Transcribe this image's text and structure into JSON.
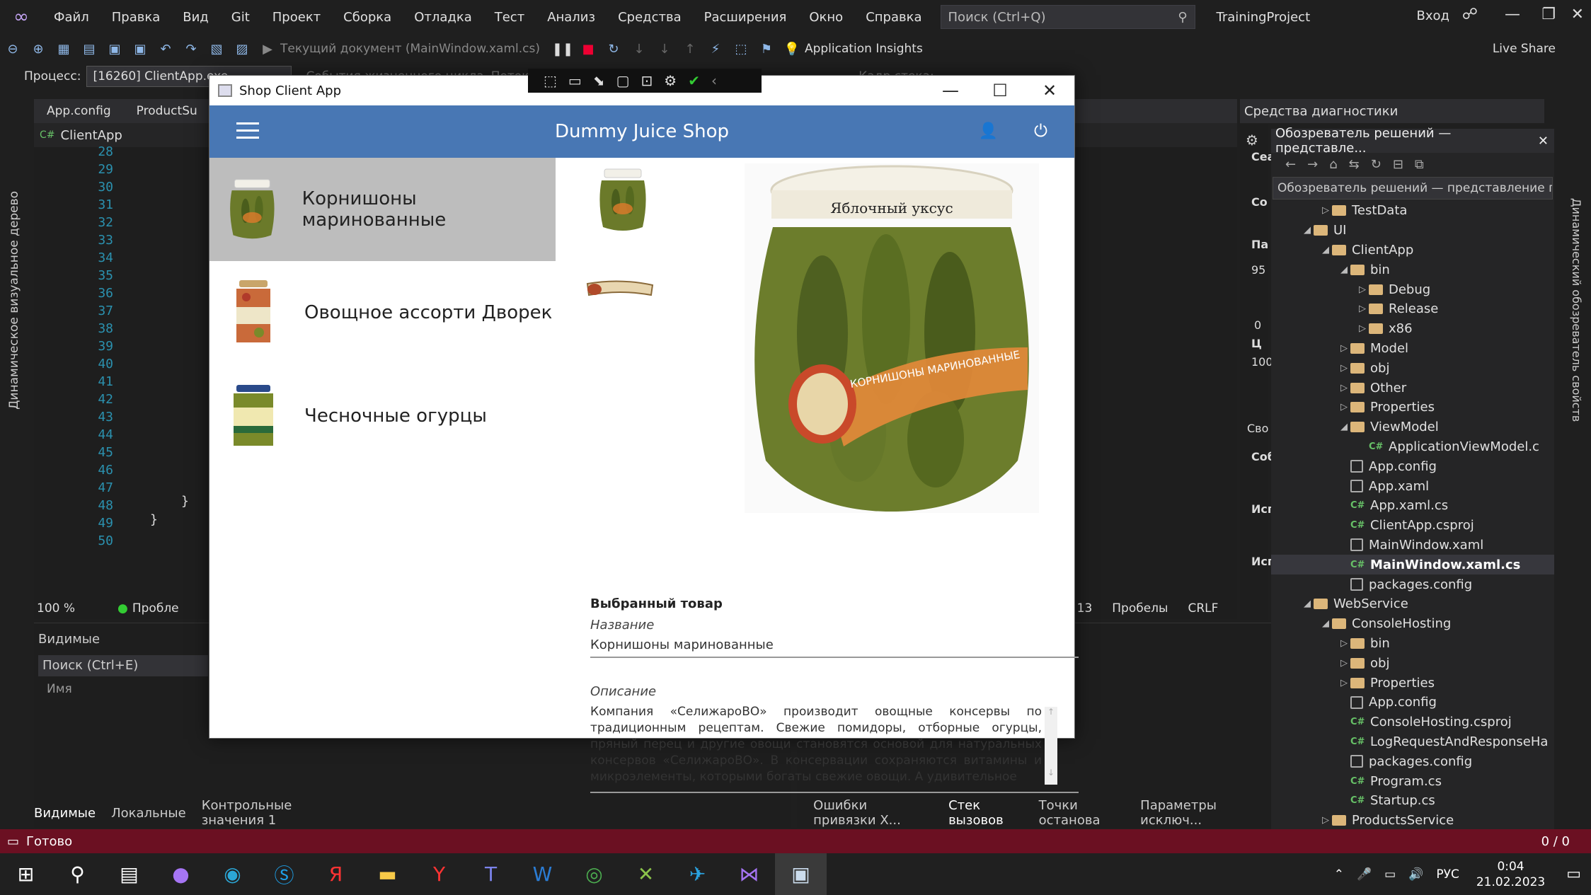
{
  "menu": [
    "Файл",
    "Правка",
    "Вид",
    "Git",
    "Проект",
    "Сборка",
    "Отладка",
    "Тест",
    "Анализ",
    "Средства",
    "Расширения",
    "Окно",
    "Справка"
  ],
  "search": {
    "placeholder": "Поиск (Ctrl+Q)"
  },
  "project_name": "TrainingProject",
  "signin": "Вход",
  "toolbar": {
    "run_target": "Текущий документ (MainWindow.xaml.cs)",
    "insights": "Application Insights",
    "live_share": "Live Share"
  },
  "process": {
    "label": "Процесс:",
    "value": "[16260] ClientApp.exe",
    "lifecycle": "События жизненного цикла",
    "thread": "Поток:",
    "stack": "Кадр стека:"
  },
  "left_panel_title": "Динамическое визуальное дерево",
  "editor": {
    "tabs": [
      "App.config",
      "ProductSu"
    ],
    "nav": "ClientApp",
    "lines": [
      "28",
      "29",
      "30",
      "31",
      "32",
      "33",
      "34",
      "35",
      "36",
      "37",
      "38",
      "39",
      "40",
      "41",
      "42",
      "43",
      "44",
      "45",
      "46",
      "47",
      "48",
      "49",
      "50"
    ],
    "code_48": "}",
    "code_49": "}",
    "zoom": "100 %",
    "problems": "Пробле",
    "ch": "мв: 13",
    "spaces": "Пробелы",
    "eol": "CRLF"
  },
  "locals": {
    "title": "Видимые",
    "search": "Поиск (Ctrl+E)",
    "col_name": "Имя"
  },
  "bottom_tabs": [
    "Видимые",
    "Локальные",
    "Контрольные значения 1"
  ],
  "bottom_tabs2": [
    "Ошибки привязки X...",
    "Стек вызовов",
    "Точки останова",
    "Параметры исключ..."
  ],
  "diagnostics": {
    "title": "Средства диагностики",
    "partial": [
      "Сеа",
      "Со",
      "Па",
      "95",
      "0",
      "Ц",
      "100",
      "Сво",
      "Соб",
      "Исп",
      "Исп"
    ]
  },
  "solution": {
    "title": "Обозреватель решений — представле...",
    "search": "Обозреватель решений — представление пап",
    "items": [
      {
        "label": "TestData",
        "indent": 3,
        "arrow": "▷",
        "kind": "folder"
      },
      {
        "label": "UI",
        "indent": 2,
        "arrow": "◢",
        "kind": "folder"
      },
      {
        "label": "ClientApp",
        "indent": 3,
        "arrow": "◢",
        "kind": "folder"
      },
      {
        "label": "bin",
        "indent": 4,
        "arrow": "◢",
        "kind": "folder"
      },
      {
        "label": "Debug",
        "indent": 5,
        "arrow": "▷",
        "kind": "folder"
      },
      {
        "label": "Release",
        "indent": 5,
        "arrow": "▷",
        "kind": "folder"
      },
      {
        "label": "x86",
        "indent": 5,
        "arrow": "▷",
        "kind": "folder"
      },
      {
        "label": "Model",
        "indent": 4,
        "arrow": "▷",
        "kind": "folder"
      },
      {
        "label": "obj",
        "indent": 4,
        "arrow": "▷",
        "kind": "folder"
      },
      {
        "label": "Other",
        "indent": 4,
        "arrow": "▷",
        "kind": "folder"
      },
      {
        "label": "Properties",
        "indent": 4,
        "arrow": "▷",
        "kind": "folder"
      },
      {
        "label": "ViewModel",
        "indent": 4,
        "arrow": "◢",
        "kind": "folder"
      },
      {
        "label": "ApplicationViewModel.c",
        "indent": 5,
        "arrow": "",
        "kind": "cs"
      },
      {
        "label": "App.config",
        "indent": 4,
        "arrow": "",
        "kind": "file"
      },
      {
        "label": "App.xaml",
        "indent": 4,
        "arrow": "",
        "kind": "file"
      },
      {
        "label": "App.xaml.cs",
        "indent": 4,
        "arrow": "",
        "kind": "cs"
      },
      {
        "label": "ClientApp.csproj",
        "indent": 4,
        "arrow": "",
        "kind": "cs"
      },
      {
        "label": "MainWindow.xaml",
        "indent": 4,
        "arrow": "",
        "kind": "file"
      },
      {
        "label": "MainWindow.xaml.cs",
        "indent": 4,
        "arrow": "",
        "kind": "cs",
        "selected": true
      },
      {
        "label": "packages.config",
        "indent": 4,
        "arrow": "",
        "kind": "file"
      },
      {
        "label": "WebService",
        "indent": 2,
        "arrow": "◢",
        "kind": "folder"
      },
      {
        "label": "ConsoleHosting",
        "indent": 3,
        "arrow": "◢",
        "kind": "folder"
      },
      {
        "label": "bin",
        "indent": 4,
        "arrow": "▷",
        "kind": "folder"
      },
      {
        "label": "obj",
        "indent": 4,
        "arrow": "▷",
        "kind": "folder"
      },
      {
        "label": "Properties",
        "indent": 4,
        "arrow": "▷",
        "kind": "folder"
      },
      {
        "label": "App.config",
        "indent": 4,
        "arrow": "",
        "kind": "file"
      },
      {
        "label": "ConsoleHosting.csproj",
        "indent": 4,
        "arrow": "",
        "kind": "cs"
      },
      {
        "label": "LogRequestAndResponseHa",
        "indent": 4,
        "arrow": "",
        "kind": "cs"
      },
      {
        "label": "packages.config",
        "indent": 4,
        "arrow": "",
        "kind": "file"
      },
      {
        "label": "Program.cs",
        "indent": 4,
        "arrow": "",
        "kind": "cs"
      },
      {
        "label": "Startup.cs",
        "indent": 4,
        "arrow": "",
        "kind": "cs"
      },
      {
        "label": "ProductsService",
        "indent": 3,
        "arrow": "▷",
        "kind": "folder"
      }
    ]
  },
  "right_vertical": "Динамический обозреватель свойств",
  "status": {
    "text": "Готово",
    "right": "0 / 0"
  },
  "taskbar": {
    "lang": "РУС",
    "time": "0:04",
    "date": "21.02.2023"
  },
  "app": {
    "window_title": "Shop Client App",
    "header_title": "Dummy Juice Shop",
    "products": [
      {
        "name": "Корнишоны маринованные",
        "selected": true
      },
      {
        "name": "Овощное ассорти Дворек",
        "selected": false
      },
      {
        "name": "Чесночные огурцы",
        "selected": false
      }
    ],
    "jar_label_top": "Яблочный уксус",
    "jar_label_brand": "КОРНИШОНЫ МАРИНОВАННЫЕ",
    "selected_heading": "Выбранный товар",
    "name_label": "Название",
    "name_value": "Корнишоны маринованные",
    "desc_label": "Описание",
    "desc_value": "Компания «СелижароВО» производит овощные консервы по традиционным рецептам. Свежие помидоры, отборные огурцы, пряный перец и другие овощи становятся основой для натуральных консервов «СелижароВО». В консервации сохраняются витамины и микроэлементы, которыми богаты свежие овощи. А удивительное"
  },
  "colors": {
    "app_header": "#4877b4",
    "status_bar": "#6b1022",
    "selected_item": "#bdbdbd"
  }
}
